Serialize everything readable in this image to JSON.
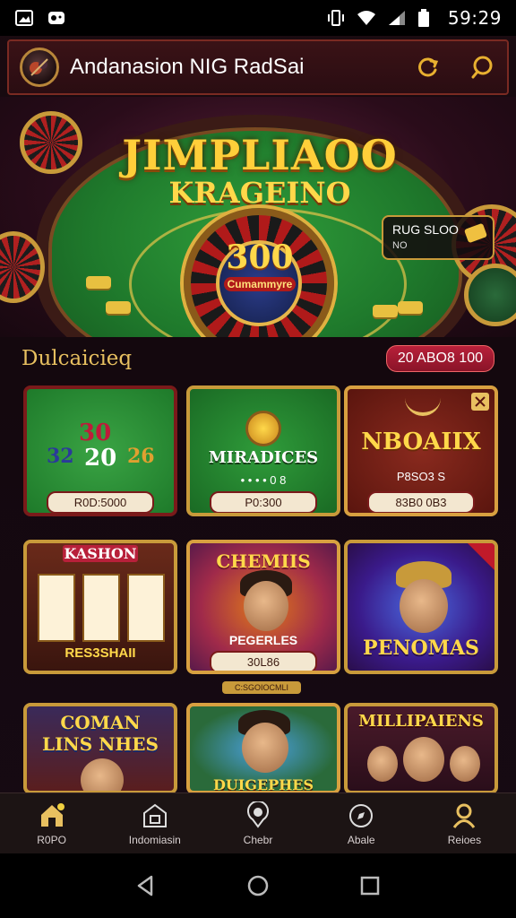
{
  "status_bar": {
    "time": "59:29"
  },
  "header": {
    "title": "Andanasion NIG RadSai"
  },
  "hero": {
    "title_line1": "JIMPLIAOO",
    "title_line2": "KRAGEINO",
    "jackpot_amount": "300",
    "jackpot_label": "Cumammyre",
    "promo_title": "RUG SLOO",
    "promo_sub": "NO"
  },
  "section": {
    "title": "Dulcaicieq",
    "badge": "20 ABO8 100"
  },
  "cards": [
    {
      "title": "",
      "numbers": [
        "30",
        "32",
        "20",
        "26"
      ],
      "pill": "R0D:5000"
    },
    {
      "title": "MIRADICES",
      "sub": "• • • • 0 8",
      "pill": "P0:300"
    },
    {
      "title": "NBOAIIX",
      "sub": "P8SO3 S",
      "pill": "83B0 0B3"
    },
    {
      "title": "KASHON",
      "sub": "RES3SHAII"
    },
    {
      "title": "CHEMIIS",
      "sub": "PEGERLES",
      "pill": "30L86"
    },
    {
      "title": "PENOMAS"
    },
    {
      "title": "COMAN LINS NHES"
    },
    {
      "title": "DUIGEPHES"
    },
    {
      "title": "MILLIPAIENS"
    }
  ],
  "divider_label": "C:SGOIOCMLI",
  "bottom_nav": [
    {
      "label": "R0PO",
      "icon": "home-icon"
    },
    {
      "label": "Indomiasin",
      "icon": "bank-icon"
    },
    {
      "label": "Chebr",
      "icon": "chat-icon"
    },
    {
      "label": "Abale",
      "icon": "compass-icon"
    },
    {
      "label": "Reioes",
      "icon": "profile-icon"
    }
  ],
  "colors": {
    "accent_gold": "#e8c060",
    "badge_red": "#b8203a",
    "header_border": "#7a2a22"
  }
}
